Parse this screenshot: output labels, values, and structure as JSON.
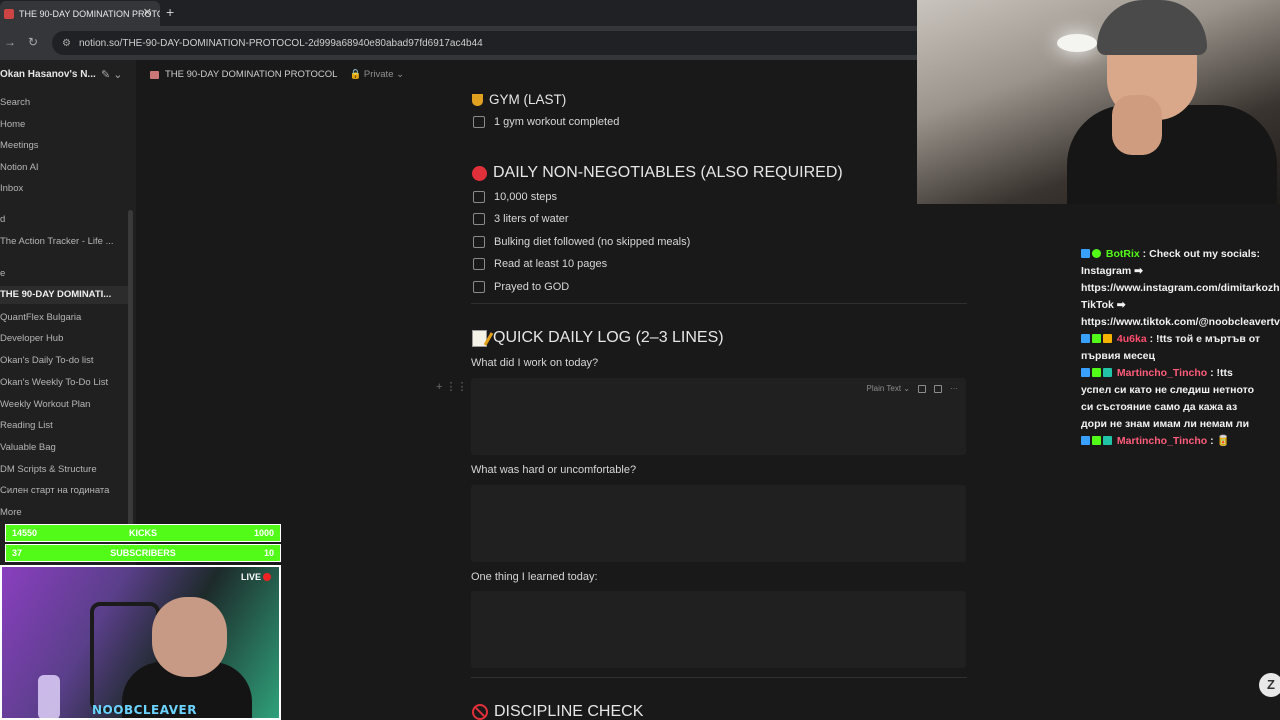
{
  "browser": {
    "tab_title": "THE 90-DAY DOMINATION PROTO",
    "new_tab": "+",
    "close": "✕",
    "url": "notion.so/THE-90-DAY-DOMINATION-PROTOCOL-2d999a68940e80abad97fd6917ac4b44"
  },
  "sidebar": {
    "workspace": "Okan Hasanov's N...",
    "items": [
      {
        "label": "Search"
      },
      {
        "label": "Home"
      },
      {
        "label": "Meetings"
      },
      {
        "label": "Notion AI"
      },
      {
        "label": "Inbox"
      },
      {
        "label": "d"
      },
      {
        "label": "The Action Tracker - Life ..."
      },
      {
        "label": "e"
      },
      {
        "label": "THE 90-DAY DOMINATI..."
      },
      {
        "label": "QuantFlex Bulgaria"
      },
      {
        "label": "Developer Hub"
      },
      {
        "label": "Okan's Daily To-do list"
      },
      {
        "label": "Okan's Weekly To-Do List"
      },
      {
        "label": "Weekly Workout Plan"
      },
      {
        "label": "Reading List"
      },
      {
        "label": "Valuable Bag"
      },
      {
        "label": "DM Scripts & Structure"
      },
      {
        "label": "Силен старт на годината"
      },
      {
        "label": "More"
      }
    ]
  },
  "topbar": {
    "page": "THE 90-DAY DOMINATION PROTOCOL",
    "privacy": "Private"
  },
  "content": {
    "gym_heading": "GYM (LAST)",
    "gym_todo": "1 gym workout completed",
    "daily_heading": "DAILY NON-NEGOTIABLES (ALSO REQUIRED)",
    "daily_todos": [
      "10,000 steps",
      "3 liters of water",
      "Bulking diet followed (no skipped meals)",
      "Read at least 10 pages",
      "Prayed to GOD"
    ],
    "log_heading": "QUICK DAILY LOG (2–3 LINES)",
    "q1": "What did I work on today?",
    "code_lang": "Plain Text",
    "q2": "What was hard or uncomfortable?",
    "q3": "One thing I learned today:",
    "discipline_heading": "DISCIPLINE CHECK"
  },
  "chat": {
    "messages": [
      {
        "user": "BotRix",
        "text": "Check out my socials: Instagram ➡ https://www.instagram.com/dimitarkozhuharov TikTok ➡ https://www.tiktok.com/@noobcleavertv"
      },
      {
        "user": "4u6ka",
        "text": "!tts той е мъртъв от първия месец"
      },
      {
        "user": "Martincho_Tincho",
        "text": "!tts успел си като не следиш нетното си състояние само да кажа аз дори не знам имам ли немам ли"
      },
      {
        "user": "Martincho_Tincho",
        "text": "🥫"
      }
    ],
    "colors": {
      "bot": "#53fc18",
      "user1": "#ff4d6d",
      "user2": "#ff5c7a"
    }
  },
  "overlay": {
    "kicks_left": "14550",
    "kicks_label": "KICKS",
    "kicks_right": "1000",
    "subs_left": "37",
    "subs_label": "SUBSCRIBERS",
    "subs_right": "10",
    "live": "LIVE",
    "handle": "NOOBCLEAVER"
  },
  "zoom_button": "Z"
}
